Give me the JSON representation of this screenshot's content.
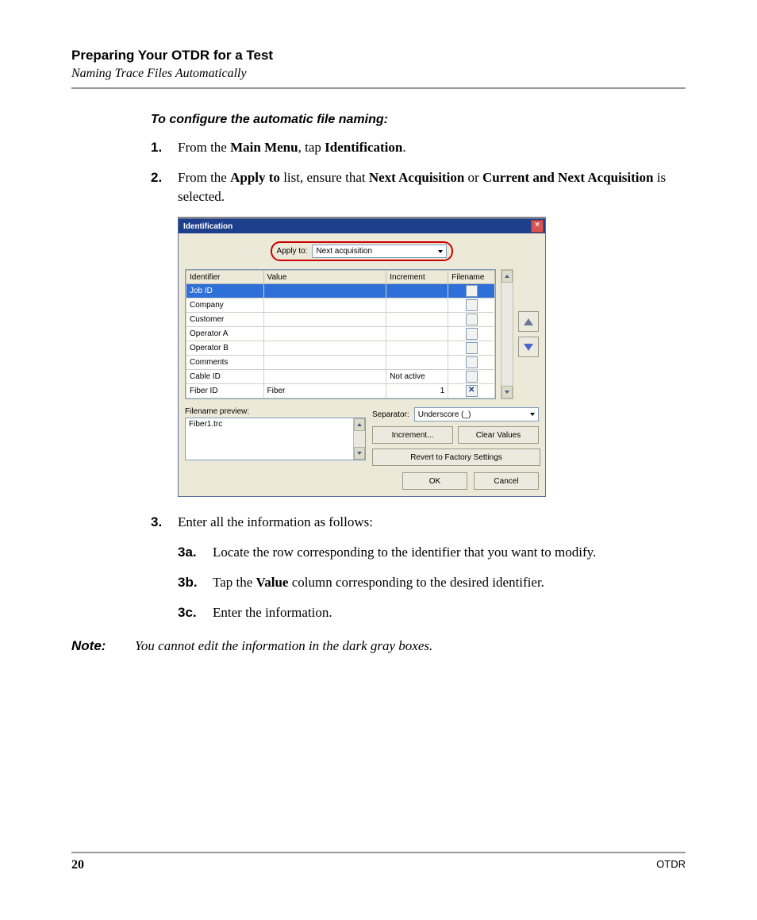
{
  "header": {
    "title": "Preparing Your OTDR for a Test",
    "subtitle": "Naming Trace Files Automatically"
  },
  "procedure": {
    "title": "To configure the automatic file naming:",
    "step1_num": "1.",
    "step1_a": "From the ",
    "step1_b": "Main Menu",
    "step1_c": ", tap ",
    "step1_d": "Identification",
    "step1_e": ".",
    "step2_num": "2.",
    "step2_a": "From the ",
    "step2_b": "Apply to",
    "step2_c": " list, ensure that ",
    "step2_d": "Next Acquisition",
    "step2_e": " or ",
    "step2_f": "Current and Next Acquisition",
    "step2_g": " is selected.",
    "step3_num": "3.",
    "step3_text": "Enter all the information as follows:",
    "step3a_num": "3a.",
    "step3a_text": "Locate the row corresponding to the identifier that you want to modify.",
    "step3b_num": "3b.",
    "step3b_a": "Tap the ",
    "step3b_b": "Value",
    "step3b_c": " column corresponding to the desired identifier.",
    "step3c_num": "3c.",
    "step3c_text": "Enter the information."
  },
  "note": {
    "label": "Note:",
    "text": "You cannot edit the information in the dark gray boxes."
  },
  "dialog": {
    "title": "Identification",
    "apply_label": "Apply to:",
    "apply_value": "Next acquisition",
    "columns": {
      "identifier": "Identifier",
      "value": "Value",
      "increment": "Increment",
      "filename": "Filename"
    },
    "rows": [
      {
        "id": "Job ID",
        "value": "",
        "increment": "",
        "filename_checked": false,
        "selected": true
      },
      {
        "id": "Company",
        "value": "",
        "increment": "",
        "filename_checked": false,
        "selected": false
      },
      {
        "id": "Customer",
        "value": "",
        "increment": "",
        "filename_checked": false,
        "selected": false
      },
      {
        "id": "Operator A",
        "value": "",
        "increment": "",
        "filename_checked": false,
        "selected": false
      },
      {
        "id": "Operator B",
        "value": "",
        "increment": "",
        "filename_checked": false,
        "selected": false
      },
      {
        "id": "Comments",
        "value": "",
        "increment": "",
        "filename_checked": false,
        "selected": false
      },
      {
        "id": "Cable ID",
        "value": "",
        "increment": "Not active",
        "filename_checked": false,
        "selected": false
      },
      {
        "id": "Fiber ID",
        "value": "Fiber",
        "increment": "1",
        "filename_checked": true,
        "selected": false
      }
    ],
    "preview_label": "Filename preview:",
    "preview_value": "Fiber1.trc",
    "separator_label": "Separator:",
    "separator_value": "Underscore (_)",
    "buttons": {
      "increment": "Increment...",
      "clear": "Clear Values",
      "revert": "Revert to Factory Settings",
      "ok": "OK",
      "cancel": "Cancel"
    }
  },
  "footer": {
    "page": "20",
    "product": "OTDR"
  }
}
